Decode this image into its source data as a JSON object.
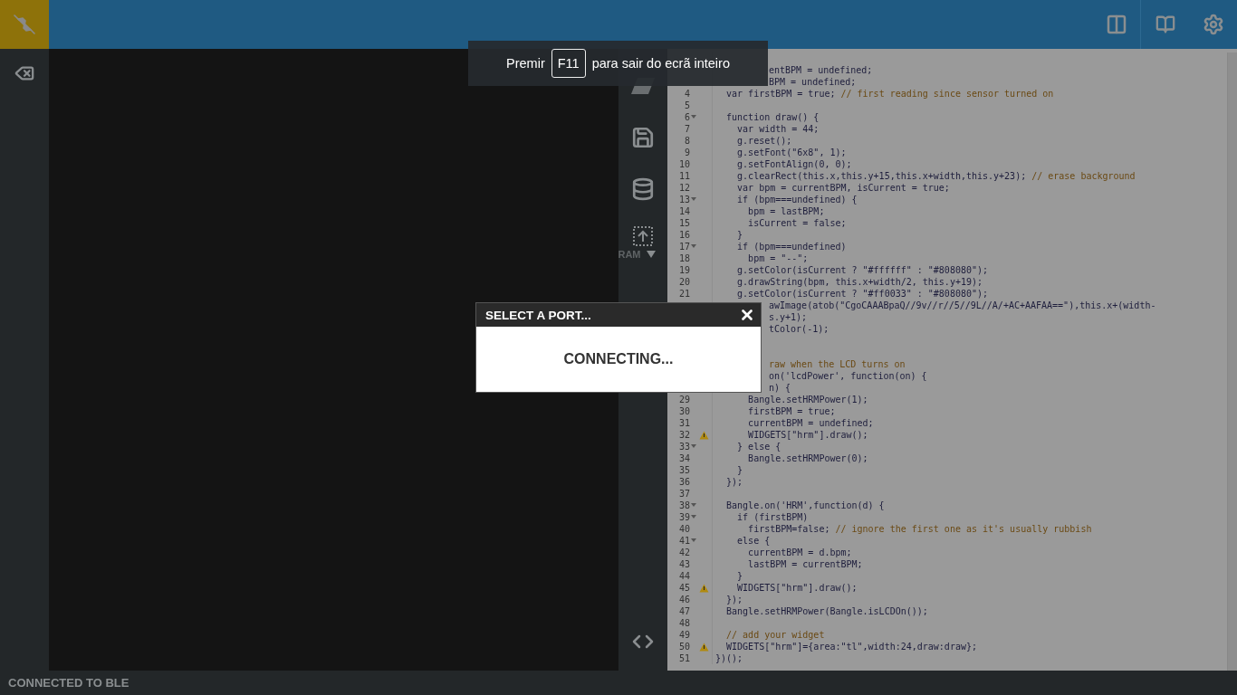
{
  "toolbar": {
    "memory_label": "RAM"
  },
  "editor": {
    "lines": [
      {
        "kind": "cut"
      },
      {
        "kind": "cut",
        "code": "entBPM = undefined;"
      },
      {
        "kind": "cut",
        "code": "BPM = undefined;"
      },
      {
        "kind": "line",
        "n": "4",
        "code": "  var firstBPM = true; ",
        "comment": "// first reading since sensor turned on"
      },
      {
        "kind": "line",
        "n": "5"
      },
      {
        "kind": "line",
        "n": "6",
        "code": "  function draw() {",
        "fold": true
      },
      {
        "kind": "line",
        "n": "7",
        "code": "    var width = 44;"
      },
      {
        "kind": "line",
        "n": "8",
        "code": "    g.reset();"
      },
      {
        "kind": "line",
        "n": "9",
        "code": "    g.setFont(\"6x8\", 1);"
      },
      {
        "kind": "line",
        "n": "10",
        "code": "    g.setFontAlign(0, 0);"
      },
      {
        "kind": "line",
        "n": "11",
        "code": "    g.clearRect(this.x,this.y+15,this.x+width,this.y+23); ",
        "comment": "// erase background"
      },
      {
        "kind": "line",
        "n": "12",
        "code": "    var bpm = currentBPM, isCurrent = true;"
      },
      {
        "kind": "line",
        "n": "13",
        "code": "    if (bpm===undefined) {",
        "fold": true
      },
      {
        "kind": "line",
        "n": "14",
        "code": "      bpm = lastBPM;"
      },
      {
        "kind": "line",
        "n": "15",
        "code": "      isCurrent = false;"
      },
      {
        "kind": "line",
        "n": "16",
        "code": "    }"
      },
      {
        "kind": "line",
        "n": "17",
        "code": "    if (bpm===undefined)",
        "fold": true
      },
      {
        "kind": "line",
        "n": "18",
        "code": "      bpm = \"--\";"
      },
      {
        "kind": "line",
        "n": "19",
        "code": "    g.setColor(isCurrent ? \"#ffffff\" : \"#808080\");"
      },
      {
        "kind": "line",
        "n": "20",
        "code": "    g.drawString(bpm, this.x+width/2, this.y+19);"
      },
      {
        "kind": "line",
        "n": "21",
        "code": "    g.setColor(isCurrent ? \"#ff0033\" : \"#808080\");"
      },
      {
        "kind": "cut",
        "code": "awImage(atob(\"CgoCAAABpaQ//9v//r//5//9L//A/+AC+AAFAA==\"),this.x+(width-"
      },
      {
        "kind": "cut",
        "code": "s.y+1);"
      },
      {
        "kind": "cut",
        "code": "tColor(-1);"
      },
      {
        "kind": "cut"
      },
      {
        "kind": "cut"
      },
      {
        "kind": "cut",
        "comment": "raw when the LCD turns on"
      },
      {
        "kind": "cut",
        "code": "on('lcdPower', function(on) {"
      },
      {
        "kind": "cut",
        "code": "n) {"
      },
      {
        "kind": "line",
        "n": "29",
        "code": "      Bangle.setHRMPower(1);"
      },
      {
        "kind": "line",
        "n": "30",
        "code": "      firstBPM = true;"
      },
      {
        "kind": "line",
        "n": "31",
        "code": "      currentBPM = undefined;"
      },
      {
        "kind": "line",
        "n": "32",
        "code": "      WIDGETS[\"hrm\"].draw();",
        "warning": true
      },
      {
        "kind": "line",
        "n": "33",
        "code": "    } else {",
        "fold": true
      },
      {
        "kind": "line",
        "n": "34",
        "code": "      Bangle.setHRMPower(0);"
      },
      {
        "kind": "line",
        "n": "35",
        "code": "    }"
      },
      {
        "kind": "line",
        "n": "36",
        "code": "  });"
      },
      {
        "kind": "line",
        "n": "37"
      },
      {
        "kind": "line",
        "n": "38",
        "code": "  Bangle.on('HRM',function(d) {",
        "fold": true
      },
      {
        "kind": "line",
        "n": "39",
        "code": "    if (firstBPM)",
        "fold": true
      },
      {
        "kind": "line",
        "n": "40",
        "code": "      firstBPM=false; ",
        "comment": "// ignore the first one as it's usually rubbish"
      },
      {
        "kind": "line",
        "n": "41",
        "code": "    else {",
        "fold": true
      },
      {
        "kind": "line",
        "n": "42",
        "code": "      currentBPM = d.bpm;"
      },
      {
        "kind": "line",
        "n": "43",
        "code": "      lastBPM = currentBPM;"
      },
      {
        "kind": "line",
        "n": "44",
        "code": "    }"
      },
      {
        "kind": "line",
        "n": "45",
        "code": "    WIDGETS[\"hrm\"].draw();",
        "warning": true
      },
      {
        "kind": "line",
        "n": "46",
        "code": "  });"
      },
      {
        "kind": "line",
        "n": "47",
        "code": "  Bangle.setHRMPower(Bangle.isLCDOn());"
      },
      {
        "kind": "line",
        "n": "48"
      },
      {
        "kind": "line",
        "n": "49",
        "comment": "  // add your widget"
      },
      {
        "kind": "line",
        "n": "50",
        "code": "  WIDGETS[\"hrm\"]={area:\"tl\",width:24,draw:draw};",
        "warning": true
      },
      {
        "kind": "line",
        "n": "51",
        "code": "})();"
      }
    ]
  },
  "dialog": {
    "title": "SELECT A PORT...",
    "message": "CONNECTING..."
  },
  "fullscreen_hint": {
    "before": "Premir",
    "key": "F11",
    "after": "para sair do ecrã inteiro"
  },
  "status_bar": "CONNECTED TO BLE"
}
